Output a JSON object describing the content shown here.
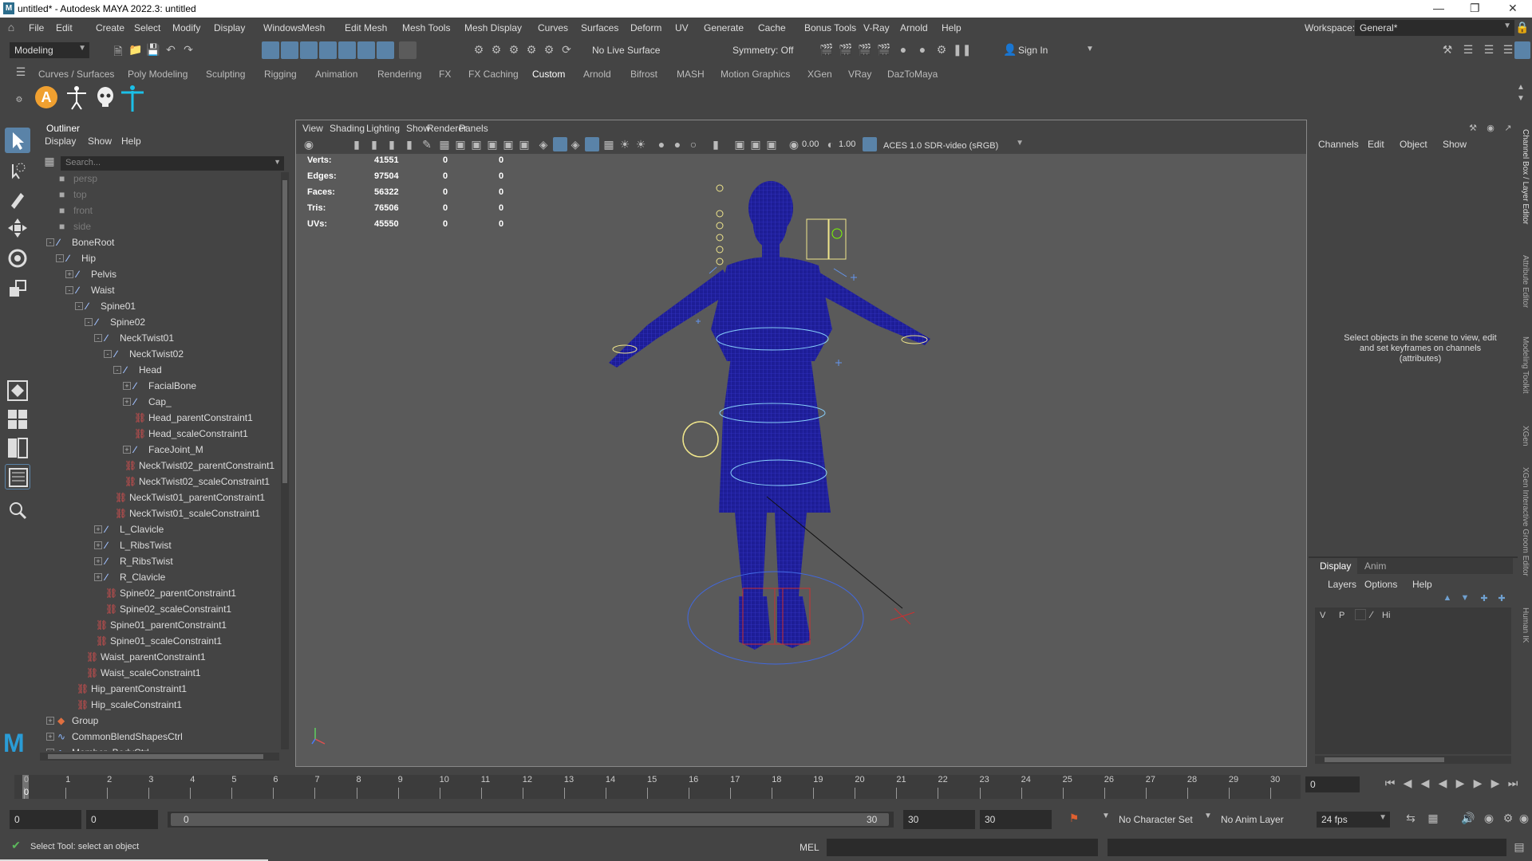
{
  "window": {
    "title": "untitled* - Autodesk MAYA 2022.3: untitled",
    "logo": "M"
  },
  "menus": [
    "File",
    "Edit",
    "Create",
    "Select",
    "Modify",
    "Display",
    "Windows",
    "Mesh",
    "Edit Mesh",
    "Mesh Tools",
    "Mesh Display",
    "Curves",
    "Surfaces",
    "Deform",
    "UV",
    "Generate",
    "Cache",
    "Bonus Tools",
    "V-Ray",
    "Arnold",
    "Help"
  ],
  "workspace": {
    "label": "Workspace:",
    "value": "General*"
  },
  "statusline": {
    "mode": "Modeling",
    "live_surface": "No Live Surface",
    "symmetry": "Symmetry: Off",
    "sign_in": "Sign In"
  },
  "shelf_tabs": [
    "Curves / Surfaces",
    "Poly Modeling",
    "Sculpting",
    "Rigging",
    "Animation",
    "Rendering",
    "FX",
    "FX Caching",
    "Custom",
    "Arnold",
    "Bifrost",
    "MASH",
    "Motion Graphics",
    "XGen",
    "VRay",
    "DazToMaya"
  ],
  "shelf_active": "Custom",
  "shelf_icons": [
    "A"
  ],
  "outliner": {
    "title": "Outliner",
    "menus": [
      "Display",
      "Show",
      "Help"
    ],
    "search_placeholder": "Search...",
    "rows": [
      {
        "label": "persp",
        "type": "camera",
        "depth": 0,
        "gray": true
      },
      {
        "label": "top",
        "type": "camera",
        "depth": 0,
        "gray": true
      },
      {
        "label": "front",
        "type": "camera",
        "depth": 0,
        "gray": true
      },
      {
        "label": "side",
        "type": "camera",
        "depth": 0,
        "gray": true
      },
      {
        "label": "BoneRoot",
        "type": "joint",
        "depth": 0,
        "exp": "-"
      },
      {
        "label": "Hip",
        "type": "joint",
        "depth": 1,
        "exp": "-"
      },
      {
        "label": "Pelvis",
        "type": "joint",
        "depth": 2,
        "exp": "+"
      },
      {
        "label": "Waist",
        "type": "joint",
        "depth": 2,
        "exp": "-"
      },
      {
        "label": "Spine01",
        "type": "joint",
        "depth": 3,
        "exp": "-"
      },
      {
        "label": "Spine02",
        "type": "joint",
        "depth": 4,
        "exp": "-"
      },
      {
        "label": "NeckTwist01",
        "type": "joint",
        "depth": 5,
        "exp": "-"
      },
      {
        "label": "NeckTwist02",
        "type": "joint",
        "depth": 6,
        "exp": "-"
      },
      {
        "label": "Head",
        "type": "joint",
        "depth": 7,
        "exp": "-"
      },
      {
        "label": "FacialBone",
        "type": "joint",
        "depth": 8,
        "exp": "+"
      },
      {
        "label": "Cap_",
        "type": "joint",
        "depth": 8,
        "exp": "+"
      },
      {
        "label": "Head_parentConstraint1",
        "type": "constraint",
        "depth": 8
      },
      {
        "label": "Head_scaleConstraint1",
        "type": "constraint",
        "depth": 8
      },
      {
        "label": "FaceJoint_M",
        "type": "joint",
        "depth": 8,
        "exp": "+"
      },
      {
        "label": "NeckTwist02_parentConstraint1",
        "type": "constraint",
        "depth": 7
      },
      {
        "label": "NeckTwist02_scaleConstraint1",
        "type": "constraint",
        "depth": 7
      },
      {
        "label": "NeckTwist01_parentConstraint1",
        "type": "constraint",
        "depth": 6
      },
      {
        "label": "NeckTwist01_scaleConstraint1",
        "type": "constraint",
        "depth": 6
      },
      {
        "label": "L_Clavicle",
        "type": "joint",
        "depth": 5,
        "exp": "+"
      },
      {
        "label": "L_RibsTwist",
        "type": "joint",
        "depth": 5,
        "exp": "+"
      },
      {
        "label": "R_RibsTwist",
        "type": "joint",
        "depth": 5,
        "exp": "+"
      },
      {
        "label": "R_Clavicle",
        "type": "joint",
        "depth": 5,
        "exp": "+"
      },
      {
        "label": "Spine02_parentConstraint1",
        "type": "constraint",
        "depth": 5
      },
      {
        "label": "Spine02_scaleConstraint1",
        "type": "constraint",
        "depth": 5
      },
      {
        "label": "Spine01_parentConstraint1",
        "type": "constraint",
        "depth": 4
      },
      {
        "label": "Spine01_scaleConstraint1",
        "type": "constraint",
        "depth": 4
      },
      {
        "label": "Waist_parentConstraint1",
        "type": "constraint",
        "depth": 3
      },
      {
        "label": "Waist_scaleConstraint1",
        "type": "constraint",
        "depth": 3
      },
      {
        "label": "Hip_parentConstraint1",
        "type": "constraint",
        "depth": 2
      },
      {
        "label": "Hip_scaleConstraint1",
        "type": "constraint",
        "depth": 2
      },
      {
        "label": "Group",
        "type": "group",
        "depth": 0,
        "exp": "+"
      },
      {
        "label": "CommonBlendShapesCtrl",
        "type": "curve",
        "depth": 0,
        "exp": "+"
      },
      {
        "label": "Member_BodyCtrl",
        "type": "curve",
        "depth": 0,
        "exp": "+"
      }
    ]
  },
  "viewport": {
    "menus": [
      "View",
      "Shading",
      "Lighting",
      "Show",
      "Renderer",
      "Panels"
    ],
    "exposure": "0.00",
    "gamma": "1.00",
    "color_space": "ACES 1.0 SDR-video (sRGB)",
    "hud": [
      {
        "label": "Verts:",
        "a": "41551",
        "b": "0",
        "c": "0"
      },
      {
        "label": "Edges:",
        "a": "97504",
        "b": "0",
        "c": "0"
      },
      {
        "label": "Faces:",
        "a": "56322",
        "b": "0",
        "c": "0"
      },
      {
        "label": "Tris:",
        "a": "76506",
        "b": "0",
        "c": "0"
      },
      {
        "label": "UVs:",
        "a": "45550",
        "b": "0",
        "c": "0"
      }
    ]
  },
  "channelbox": {
    "menus": [
      "Channels",
      "Edit",
      "Object",
      "Show"
    ],
    "message": "Select objects in the scene to view, edit and set keyframes on channels (attributes)",
    "layer_tabs": [
      "Display",
      "Anim"
    ],
    "layer_menus": [
      "Layers",
      "Options",
      "Help"
    ],
    "layer_cols": [
      "V",
      "P",
      "Hi"
    ]
  },
  "side_tabs": [
    "Channel Box / Layer Editor",
    "Attribute Editor",
    "Modeling Toolkit",
    "XGen",
    "XGen Interactive Groom Editor",
    "Human IK"
  ],
  "timeline": {
    "ticks": [
      "0",
      "1",
      "2",
      "3",
      "4",
      "5",
      "6",
      "7",
      "8",
      "9",
      "10",
      "11",
      "12",
      "13",
      "14",
      "15",
      "16",
      "17",
      "18",
      "19",
      "20",
      "21",
      "22",
      "23",
      "24",
      "25",
      "26",
      "27",
      "28",
      "29",
      "30"
    ],
    "current_frame": "0",
    "frame_field": "0"
  },
  "range": {
    "start": "0",
    "anim_start": "0",
    "range_start": "0",
    "range_end": "30",
    "end": "30",
    "anim_end": "30",
    "character_set": "No Character Set",
    "anim_layer": "No Anim Layer",
    "fps": "24 fps"
  },
  "help": {
    "text": "Select Tool: select an object",
    "mel": "MEL"
  },
  "colors": {
    "accent": "#5a83a8",
    "wire": "#1a1a8c",
    "joint_icon": "#a0c0ff",
    "constraint_icon": "#e05050",
    "active_tab": "#ffffff"
  }
}
